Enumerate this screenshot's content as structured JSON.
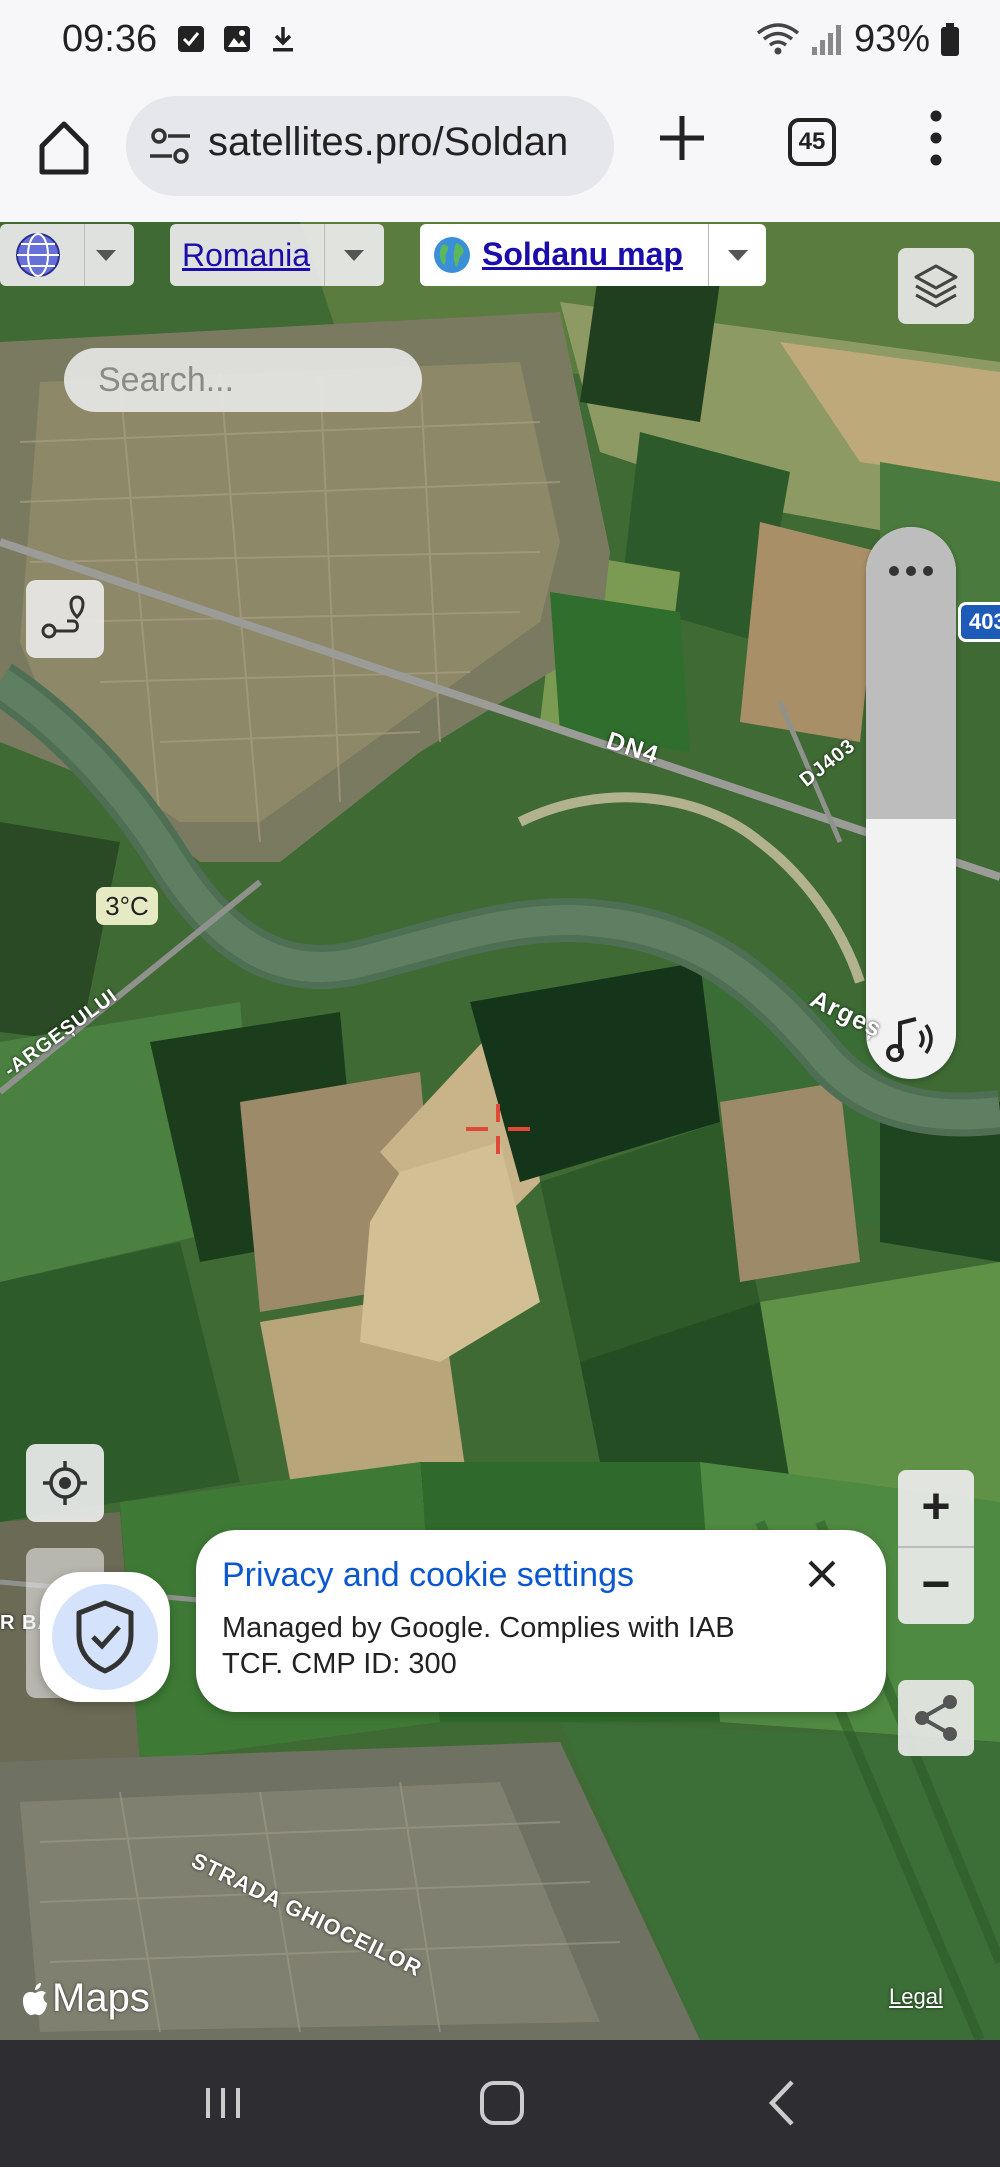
{
  "status_bar": {
    "time": "09:36",
    "battery": "93%"
  },
  "browser": {
    "url": "satellites.pro/Soldan",
    "tab_count": "45"
  },
  "map": {
    "country_label": "Romania",
    "map_name": "Soldanu map",
    "search_placeholder": "Search...",
    "temperature": "3°C",
    "road_shield": "403",
    "labels": {
      "dn4": "DN4",
      "dj403": "DJ403",
      "arges_river": "Argeș",
      "road_argesului": "-ARGEȘULUI",
      "strada_ghioceilor": "STRADA GHIOCEILOR",
      "road_partial": "R BA"
    },
    "zoom_in": "+",
    "zoom_out": "−",
    "maps_brand": "Maps",
    "legal": "Legal"
  },
  "privacy": {
    "title": "Privacy and cookie settings",
    "body": "Managed by Google. Complies with IAB TCF. CMP ID: 300",
    "close": "✕"
  },
  "colors": {
    "link_blue": "#1a0dab",
    "privacy_blue": "#0b57d0",
    "nav_bar": "#2e2e32",
    "shield_bg": "#d4e3fb"
  }
}
